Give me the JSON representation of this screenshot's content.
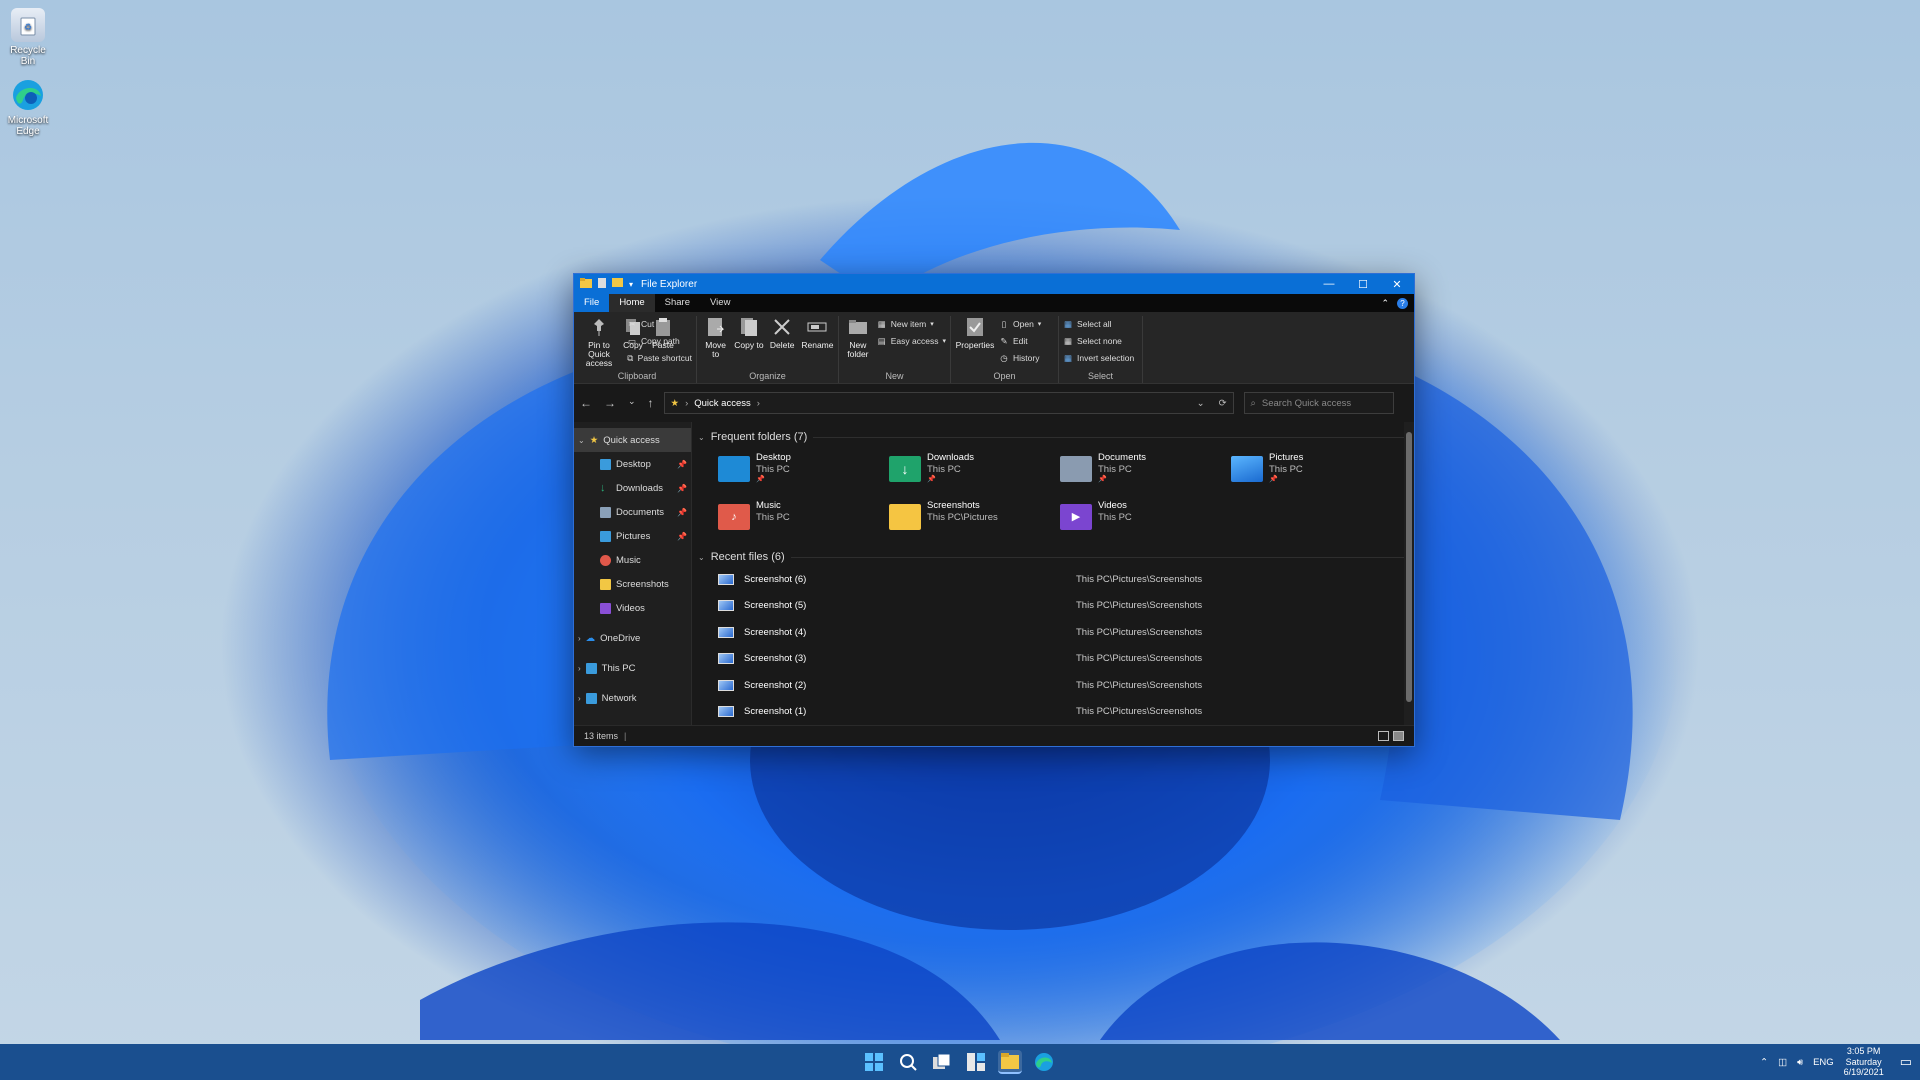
{
  "desktop": {
    "icons": [
      {
        "label": "Recycle Bin",
        "icon": "recycle-bin-icon"
      },
      {
        "label": "Microsoft Edge",
        "icon": "edge-icon"
      }
    ]
  },
  "window": {
    "title": "File Explorer",
    "tabs": [
      "File",
      "Home",
      "Share",
      "View"
    ],
    "active_tab": "Home",
    "ribbon": {
      "clipboard": {
        "label": "Clipboard",
        "pin": "Pin to Quick access",
        "copy": "Copy",
        "paste": "Paste",
        "cut": "Cut",
        "copy_path": "Copy path",
        "paste_shortcut": "Paste shortcut"
      },
      "organize": {
        "label": "Organize",
        "move_to": "Move to",
        "copy_to": "Copy to",
        "delete": "Delete",
        "rename": "Rename"
      },
      "new": {
        "label": "New",
        "new_folder": "New folder",
        "new_item": "New item",
        "easy_access": "Easy access"
      },
      "open": {
        "label": "Open",
        "properties": "Properties",
        "open": "Open",
        "edit": "Edit",
        "history": "History"
      },
      "select": {
        "label": "Select",
        "select_all": "Select all",
        "select_none": "Select none",
        "invert_selection": "Invert selection"
      }
    },
    "address": {
      "path": "Quick access",
      "search_placeholder": "Search Quick access"
    },
    "nav_pane": {
      "quick_access": "Quick access",
      "pinned": [
        {
          "label": "Desktop",
          "pinned": true,
          "color": "#3a9bdc"
        },
        {
          "label": "Downloads",
          "pinned": true,
          "color": "#2ab07a"
        },
        {
          "label": "Documents",
          "pinned": true,
          "color": "#8aa0b8"
        },
        {
          "label": "Pictures",
          "pinned": true,
          "color": "#3a9bdc"
        },
        {
          "label": "Music",
          "pinned": false,
          "color": "#e0584a"
        },
        {
          "label": "Screenshots",
          "pinned": false,
          "color": "#f2c744"
        },
        {
          "label": "Videos",
          "pinned": false,
          "color": "#8a4fd6"
        }
      ],
      "roots": [
        {
          "label": "OneDrive",
          "color": "#2a8ce8"
        },
        {
          "label": "This PC",
          "color": "#3a9bdc"
        },
        {
          "label": "Network",
          "color": "#3a9bdc"
        }
      ]
    },
    "frequent": {
      "heading": "Frequent folders (7)",
      "items": [
        {
          "name": "Desktop",
          "location": "This PC",
          "pinned": true,
          "color": "#1e8ad6"
        },
        {
          "name": "Downloads",
          "location": "This PC",
          "pinned": true,
          "color": "#1fa36b"
        },
        {
          "name": "Documents",
          "location": "This PC",
          "pinned": true,
          "color": "#8a9bb0"
        },
        {
          "name": "Pictures",
          "location": "This PC",
          "pinned": true,
          "color": "#2b94e6"
        },
        {
          "name": "Music",
          "location": "This PC",
          "pinned": false,
          "color": "#e05a4a"
        },
        {
          "name": "Screenshots",
          "location": "This PC\\Pictures",
          "pinned": false,
          "color": "#f5c542"
        },
        {
          "name": "Videos",
          "location": "This PC",
          "pinned": false,
          "color": "#7b45d0"
        }
      ]
    },
    "recent": {
      "heading": "Recent files (6)",
      "files": [
        {
          "name": "Screenshot (6)",
          "path": "This PC\\Pictures\\Screenshots"
        },
        {
          "name": "Screenshot (5)",
          "path": "This PC\\Pictures\\Screenshots"
        },
        {
          "name": "Screenshot (4)",
          "path": "This PC\\Pictures\\Screenshots"
        },
        {
          "name": "Screenshot (3)",
          "path": "This PC\\Pictures\\Screenshots"
        },
        {
          "name": "Screenshot (2)",
          "path": "This PC\\Pictures\\Screenshots"
        },
        {
          "name": "Screenshot (1)",
          "path": "This PC\\Pictures\\Screenshots"
        }
      ]
    },
    "status": {
      "items": "13 items"
    }
  },
  "taskbar": {
    "apps": [
      "start-icon",
      "search-icon",
      "task-view-icon",
      "widgets-icon",
      "file-explorer-icon",
      "edge-icon"
    ],
    "lang": "ENG",
    "time": "3:05 PM",
    "day": "Saturday",
    "date": "6/19/2021"
  },
  "colors": {
    "accent": "#0a6fd6",
    "window_bg": "#191919",
    "taskbar": "#1a4f8f"
  }
}
